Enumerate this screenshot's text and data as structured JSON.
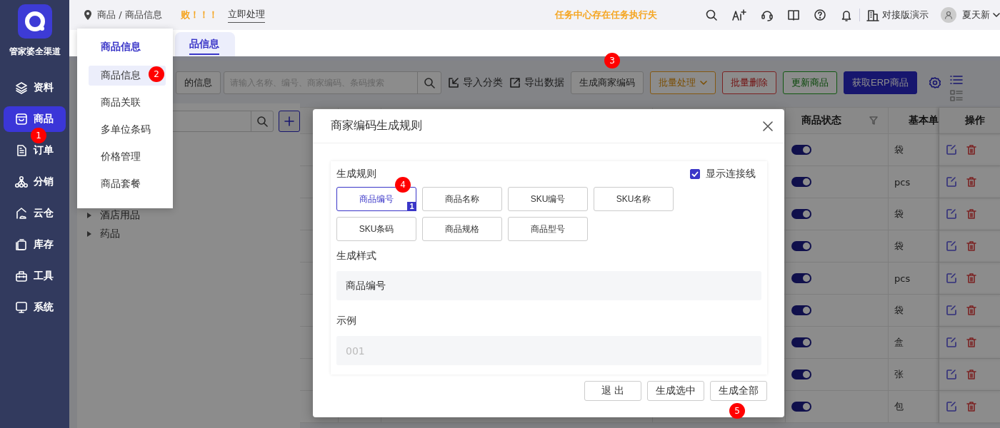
{
  "sidebar": {
    "brand": "管家婆全渠道",
    "items": [
      {
        "label": "资料",
        "selected": false
      },
      {
        "label": "商品",
        "selected": true
      },
      {
        "label": "订单",
        "selected": false
      },
      {
        "label": "分销",
        "selected": false
      },
      {
        "label": "云仓",
        "selected": false
      },
      {
        "label": "库存",
        "selected": false
      },
      {
        "label": "工具",
        "selected": false
      },
      {
        "label": "系统",
        "selected": false
      }
    ]
  },
  "topbar": {
    "breadcrumb": "商品 / 商品信息",
    "alert": "败！！！",
    "alert_action": "立即处理",
    "task_notice": "任务中心存在任务执行失",
    "account": "对接版演示",
    "user": "夏天新"
  },
  "tabs": [
    {
      "label": "品信息",
      "selected": true
    }
  ],
  "toolbar": {
    "items": [
      {
        "kind": "default",
        "label": "的信息"
      },
      {
        "kind": "search",
        "placeholder": "请输入名称、编号、商家编码、条码搜索"
      },
      {
        "kind": "import",
        "label": "导入分类"
      },
      {
        "kind": "export",
        "label": "导出数据"
      },
      {
        "kind": "default",
        "label": "生成商家编码"
      },
      {
        "kind": "warning",
        "label": "批量处理"
      },
      {
        "kind": "danger",
        "label": "批量删除"
      },
      {
        "kind": "success",
        "label": "更新商品"
      },
      {
        "kind": "primary",
        "label": "获取ERP商品"
      }
    ]
  },
  "category_tree": {
    "items": [
      {
        "label": "酒店用品",
        "expanded": false
      },
      {
        "label": "药品",
        "expanded": false
      }
    ]
  },
  "table": {
    "columns": [
      {
        "label": "商品状态",
        "filter": true
      },
      {
        "label": "基本单",
        "filter": false
      },
      {
        "label": "操作",
        "filter": false
      }
    ],
    "rows": [
      {
        "status_on": true,
        "unit": "袋"
      },
      {
        "status_on": true,
        "unit": "pcs"
      },
      {
        "status_on": true,
        "unit": "袋"
      },
      {
        "status_on": true,
        "unit": "袋"
      },
      {
        "status_on": true,
        "unit": "pcs"
      },
      {
        "status_on": true,
        "unit": "袋"
      },
      {
        "status_on": true,
        "unit": "盒"
      },
      {
        "status_on": true,
        "unit": "张"
      },
      {
        "status_on": true,
        "unit": "包"
      }
    ]
  },
  "nav_menu": {
    "title": "商品信息",
    "items": [
      {
        "label": "商品信息",
        "selected": true
      },
      {
        "label": "商品关联",
        "selected": false
      },
      {
        "label": "多单位条码",
        "selected": false
      },
      {
        "label": "价格管理",
        "selected": false
      },
      {
        "label": "商品套餐",
        "selected": false
      }
    ]
  },
  "dialog": {
    "title": "商家编码生成规则",
    "rules_label": "生成规则",
    "show_lines": {
      "label": "显示连接线",
      "checked": true
    },
    "rules": [
      {
        "label": "商品编号",
        "selected": true,
        "order": "1"
      },
      {
        "label": "商品名称",
        "selected": false
      },
      {
        "label": "SKU编号",
        "selected": false
      },
      {
        "label": "SKU名称",
        "selected": false
      },
      {
        "label": "SKU条码",
        "selected": false
      },
      {
        "label": "商品规格",
        "selected": false
      },
      {
        "label": "商品型号",
        "selected": false
      }
    ],
    "pattern_label": "生成样式",
    "pattern_value": "商品编号",
    "example_label": "示例",
    "example_placeholder": "001",
    "buttons": [
      "退 出",
      "生成选中",
      "生成全部"
    ]
  },
  "markers": [
    "1",
    "2",
    "3",
    "4",
    "5"
  ]
}
